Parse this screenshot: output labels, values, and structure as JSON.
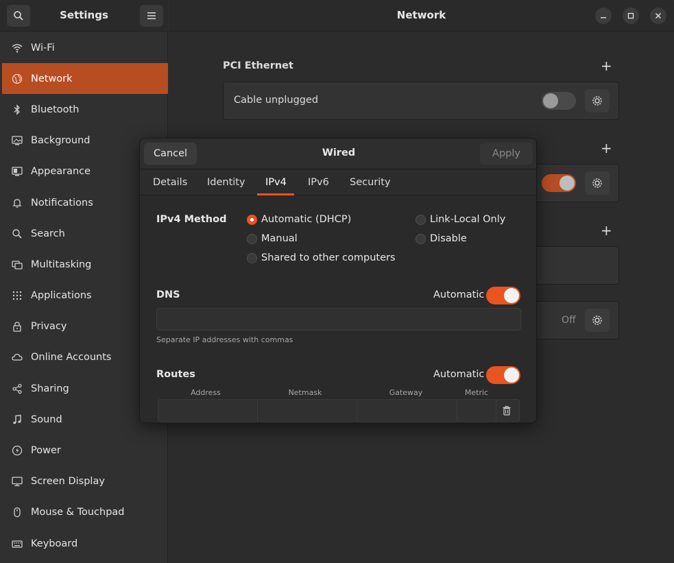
{
  "sidebar": {
    "title": "Settings",
    "items": [
      {
        "label": "Wi-Fi",
        "icon": "wifi-icon"
      },
      {
        "label": "Network",
        "icon": "network-icon",
        "active": true
      },
      {
        "label": "Bluetooth",
        "icon": "bluetooth-icon"
      },
      {
        "label": "Background",
        "icon": "background-icon"
      },
      {
        "label": "Appearance",
        "icon": "appearance-icon"
      },
      {
        "label": "Notifications",
        "icon": "bell-icon"
      },
      {
        "label": "Search",
        "icon": "search-icon"
      },
      {
        "label": "Multitasking",
        "icon": "multitasking-icon"
      },
      {
        "label": "Applications",
        "icon": "applications-grid-icon"
      },
      {
        "label": "Privacy",
        "icon": "lock-icon"
      },
      {
        "label": "Online Accounts",
        "icon": "cloud-icon"
      },
      {
        "label": "Sharing",
        "icon": "share-icon"
      },
      {
        "label": "Sound",
        "icon": "music-note-icon"
      },
      {
        "label": "Power",
        "icon": "power-icon"
      },
      {
        "label": "Screen Display",
        "icon": "display-icon"
      },
      {
        "label": "Mouse & Touchpad",
        "icon": "mouse-icon"
      },
      {
        "label": "Keyboard",
        "icon": "keyboard-icon"
      }
    ]
  },
  "header": {
    "title": "Network"
  },
  "main": {
    "pci_ethernet": {
      "title": "PCI Ethernet",
      "status": "Cable unplugged",
      "enabled": false
    },
    "vpn_row_state": "Off"
  },
  "dialog": {
    "title": "Wired",
    "cancel_label": "Cancel",
    "apply_label": "Apply",
    "tabs": [
      "Details",
      "Identity",
      "IPv4",
      "IPv6",
      "Security"
    ],
    "active_tab": "IPv4",
    "ipv4_method_label": "IPv4 Method",
    "methods": {
      "automatic": "Automatic (DHCP)",
      "manual": "Manual",
      "shared": "Shared to other computers",
      "link_local": "Link-Local Only",
      "disable": "Disable"
    },
    "selected_method": "Automatic (DHCP)",
    "dns": {
      "label": "DNS",
      "automatic_label": "Automatic",
      "automatic": true,
      "value": "",
      "hint": "Separate IP addresses with commas"
    },
    "routes": {
      "label": "Routes",
      "automatic_label": "Automatic",
      "automatic": true,
      "columns": [
        "Address",
        "Netmask",
        "Gateway",
        "Metric"
      ]
    }
  },
  "colors": {
    "accent": "#e95420",
    "sidebar_active": "#b84d22"
  }
}
